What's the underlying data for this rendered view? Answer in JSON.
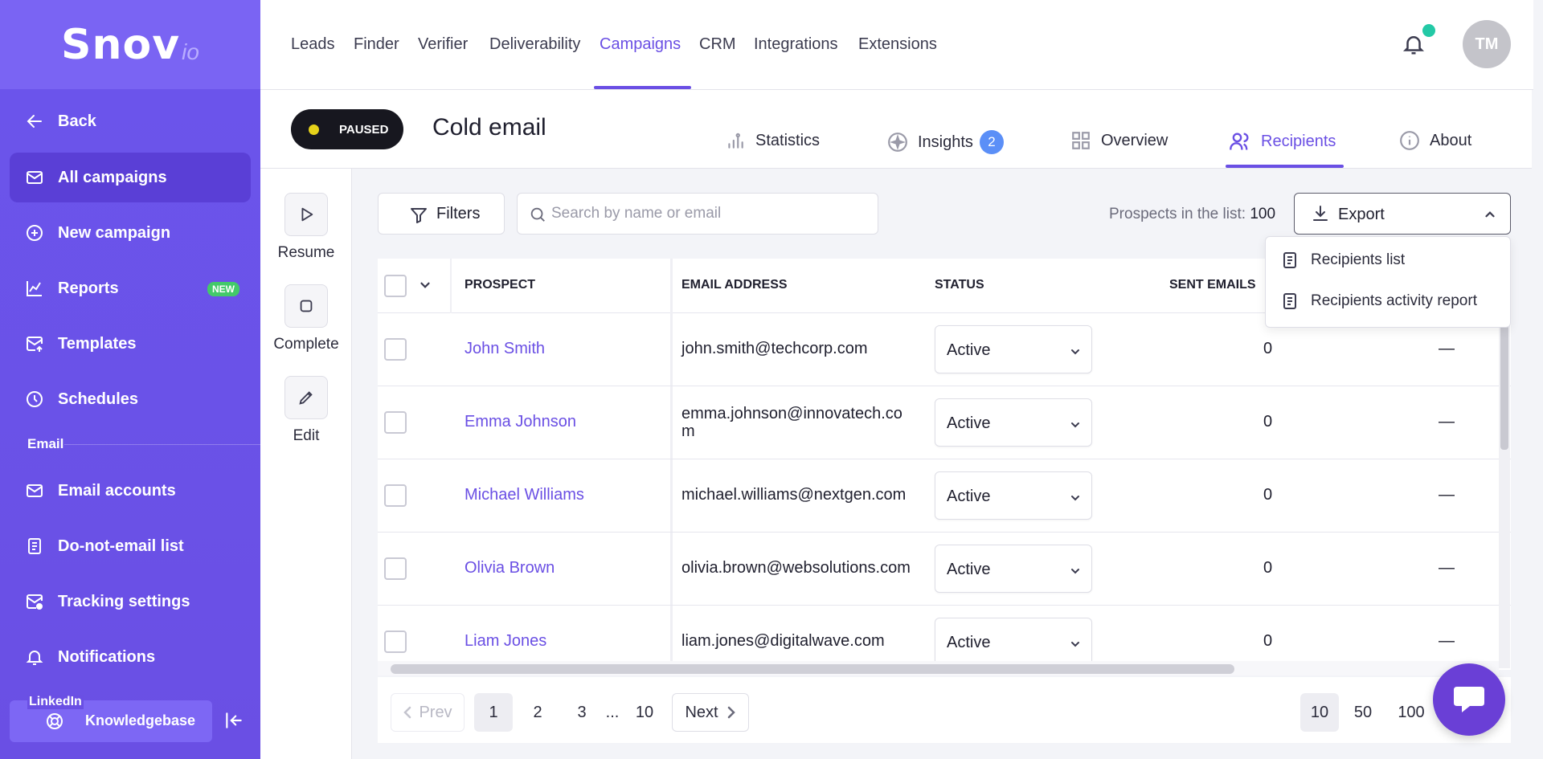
{
  "brand": {
    "name": "Snov",
    "suffix": "io"
  },
  "sidebar": {
    "items": [
      {
        "label": "Back",
        "icon": "arrow-left-icon"
      },
      {
        "label": "All campaigns",
        "icon": "mail-icon"
      },
      {
        "label": "New campaign",
        "icon": "plus-circle-icon"
      },
      {
        "label": "Reports",
        "icon": "chart-line-icon",
        "badge": "NEW"
      },
      {
        "label": "Templates",
        "icon": "mail-upload-icon"
      },
      {
        "label": "Schedules",
        "icon": "clock-icon"
      }
    ],
    "section_email": "Email",
    "email_items": [
      {
        "label": "Email accounts",
        "icon": "mail-icon"
      },
      {
        "label": "Do-not-email list",
        "icon": "document-icon"
      },
      {
        "label": "Tracking settings",
        "icon": "mail-settings-icon"
      },
      {
        "label": "Notifications",
        "icon": "bell-icon"
      }
    ],
    "section_linkedin": "LinkedIn",
    "knowledgebase": "Knowledgebase"
  },
  "topnav": {
    "items": [
      "Leads",
      "Finder",
      "Verifier",
      "Deliverability",
      "Campaigns",
      "CRM",
      "Integrations",
      "Extensions"
    ],
    "active": "Campaigns",
    "avatar_initials": "TM"
  },
  "campaign": {
    "status": "PAUSED",
    "title": "Cold email",
    "tabs": [
      {
        "label": "Statistics",
        "icon": "bar-chart-icon"
      },
      {
        "label": "Insights",
        "icon": "sparkle-icon",
        "badge": "2"
      },
      {
        "label": "Overview",
        "icon": "grid-icon"
      },
      {
        "label": "Recipients",
        "icon": "users-icon"
      },
      {
        "label": "About",
        "icon": "info-icon"
      }
    ],
    "active_tab": "Recipients"
  },
  "actions": [
    {
      "label": "Resume",
      "icon": "play-icon"
    },
    {
      "label": "Complete",
      "icon": "stop-icon"
    },
    {
      "label": "Edit",
      "icon": "pencil-icon"
    }
  ],
  "toolbar": {
    "filters_label": "Filters",
    "search_placeholder": "Search by name or email",
    "prospects_label": "Prospects in the list:",
    "prospects_count": "100",
    "export_label": "Export"
  },
  "export_menu": [
    "Recipients list",
    "Recipients activity report"
  ],
  "table": {
    "headers": [
      "PROSPECT",
      "EMAIL ADDRESS",
      "STATUS",
      "SENT EMAILS"
    ],
    "rows": [
      {
        "name": "John Smith",
        "email": "john.smith@techcorp.com",
        "status": "Active",
        "sent": "0",
        "extra": "—"
      },
      {
        "name": "Emma Johnson",
        "email": "emma.johnson@innovatech.com",
        "status": "Active",
        "sent": "0",
        "extra": "—"
      },
      {
        "name": "Michael Williams",
        "email": "michael.williams@nextgen.com",
        "status": "Active",
        "sent": "0",
        "extra": "—"
      },
      {
        "name": "Olivia Brown",
        "email": "olivia.brown@websolutions.com",
        "status": "Active",
        "sent": "0",
        "extra": "—"
      },
      {
        "name": "Liam Jones",
        "email": "liam.jones@digitalwave.com",
        "status": "Active",
        "sent": "0",
        "extra": "—"
      }
    ]
  },
  "pagination": {
    "prev": "Prev",
    "pages": [
      "1",
      "2",
      "3",
      "...",
      "10"
    ],
    "current": "1",
    "next": "Next",
    "per_page": [
      "10",
      "50",
      "100"
    ],
    "per_page_current": "10"
  },
  "colors": {
    "accent": "#6a4fe4",
    "sidebar": "#6b55ec",
    "new_badge": "#43c96a",
    "paused_dot": "#e6d21a"
  }
}
